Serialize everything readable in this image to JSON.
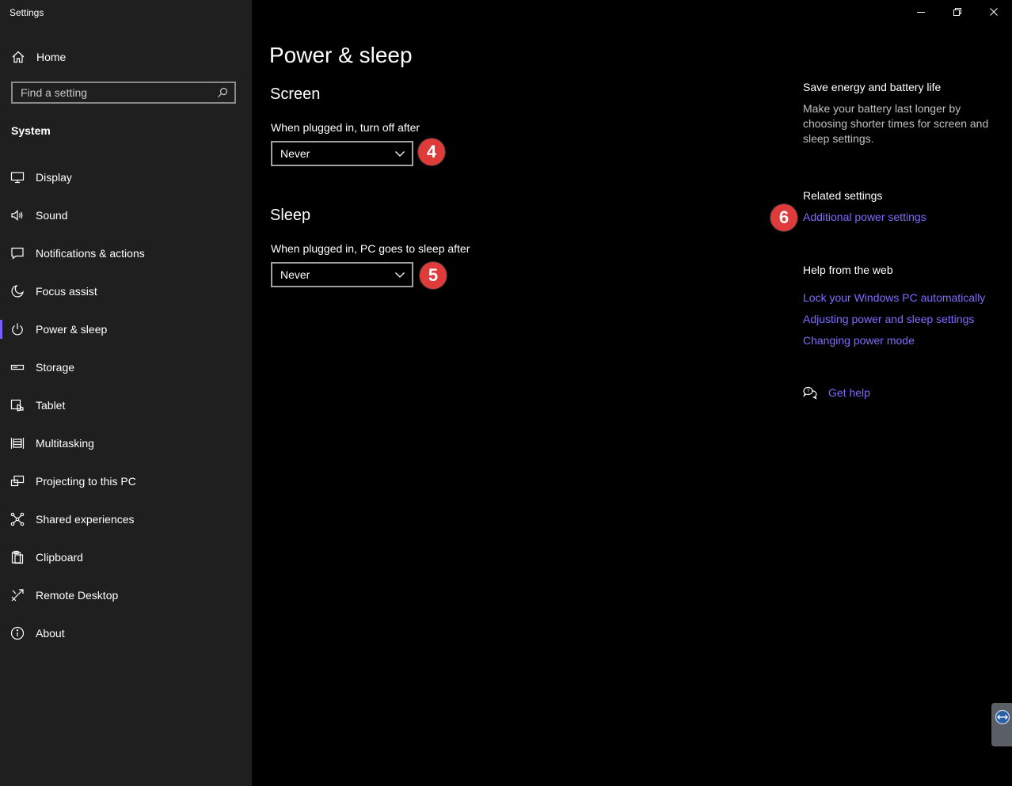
{
  "window": {
    "app_title": "Settings",
    "controls": [
      "minimize",
      "restore",
      "close"
    ]
  },
  "sidebar": {
    "home_label": "Home",
    "search_placeholder": "Find a setting",
    "section_label": "System",
    "active_item": "Power & sleep",
    "accent_color": "#7a5cff",
    "items": [
      {
        "label": "Display",
        "icon": "monitor-icon"
      },
      {
        "label": "Sound",
        "icon": "speaker-icon"
      },
      {
        "label": "Notifications & actions",
        "icon": "notification-icon"
      },
      {
        "label": "Focus assist",
        "icon": "moon-icon"
      },
      {
        "label": "Power & sleep",
        "icon": "power-icon"
      },
      {
        "label": "Storage",
        "icon": "storage-icon"
      },
      {
        "label": "Tablet",
        "icon": "tablet-icon"
      },
      {
        "label": "Multitasking",
        "icon": "multitasking-icon"
      },
      {
        "label": "Projecting to this PC",
        "icon": "projecting-icon"
      },
      {
        "label": "Shared experiences",
        "icon": "shared-icon"
      },
      {
        "label": "Clipboard",
        "icon": "clipboard-icon"
      },
      {
        "label": "Remote Desktop",
        "icon": "remote-desktop-icon"
      },
      {
        "label": "About",
        "icon": "info-icon"
      }
    ]
  },
  "main": {
    "page_title": "Power & sleep",
    "screen": {
      "heading": "Screen",
      "label": "When plugged in, turn off after",
      "value": "Never",
      "badge": "4"
    },
    "sleep": {
      "heading": "Sleep",
      "label": "When plugged in, PC goes to sleep after",
      "value": "Never",
      "badge": "5"
    }
  },
  "right_panel": {
    "save_energy_heading": "Save energy and battery life",
    "save_energy_text": "Make your battery last longer by choosing shorter times for screen and sleep settings.",
    "related_heading": "Related settings",
    "related_link": "Additional power settings",
    "related_badge": "6",
    "help_heading": "Help from the web",
    "help_links": [
      "Lock your Windows PC automatically",
      "Adjusting power and sleep settings",
      "Changing power mode"
    ],
    "get_help": "Get help",
    "link_color": "#7d6cff",
    "badge_color": "#e03b3b"
  }
}
